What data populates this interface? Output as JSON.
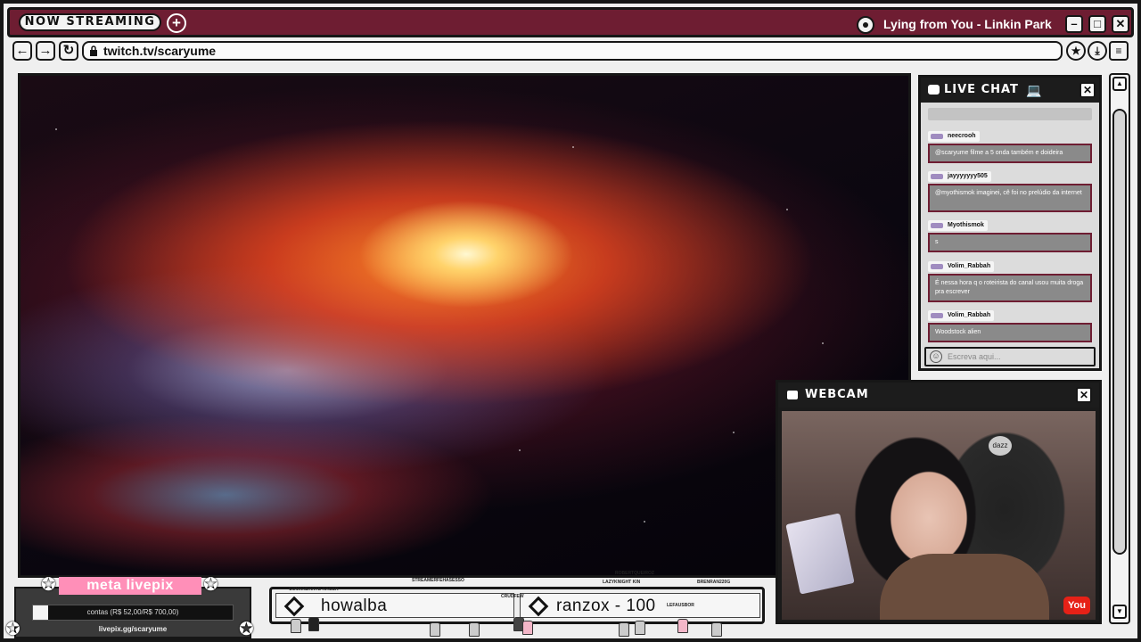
{
  "titlebar": {
    "badge": "NOW STREAMING",
    "add_label": "+",
    "song": "Lying from You - Linkin Park",
    "minimize": "–",
    "maximize": "□",
    "close": "✕"
  },
  "navbar": {
    "back": "←",
    "forward": "→",
    "reload": "↻",
    "url": "twitch.tv/scaryume",
    "icons": [
      "favorite-icon",
      "download-icon",
      "menu-icon"
    ]
  },
  "chat": {
    "title": "LIVE CHAT",
    "close": "✕",
    "messages": [
      {
        "user": "neecrooh",
        "text": "@scaryume filme a 5 onda também e doideira"
      },
      {
        "user": "jayyyyyyy505",
        "text": "@myothismok imaginei, cê foi no prelúdio da internet"
      },
      {
        "user": "Myothismok",
        "text": "s"
      },
      {
        "user": "Volim_Rabbah",
        "text": "É nessa hora q o roteirista do canal usou muita droga pra escrever"
      },
      {
        "user": "Volim_Rabbah",
        "text": "Woodstock alien"
      }
    ],
    "input_placeholder": "Escreva aqui..."
  },
  "webcam": {
    "title": "WEBCAM",
    "close": "✕",
    "chair_brand": "dazz",
    "yt_label": "You"
  },
  "livepix": {
    "title": "meta livepix",
    "progress_label": "contas (R$ 52,00/R$ 700,00)",
    "progress_fraction": 0.074,
    "url": "livepix.gg/scaryume"
  },
  "donors": {
    "first": "howalba",
    "second": "ranzox - 100"
  },
  "overlay_labels": [
    "COMANDANTE KAGER",
    "STREAMERFEHASESSO",
    "ROBERTQUEIROZ",
    "LAZYKNIGHT KIN",
    "BRENRAN220G",
    "CRUDFEW",
    "LEFAUSBOR"
  ]
}
